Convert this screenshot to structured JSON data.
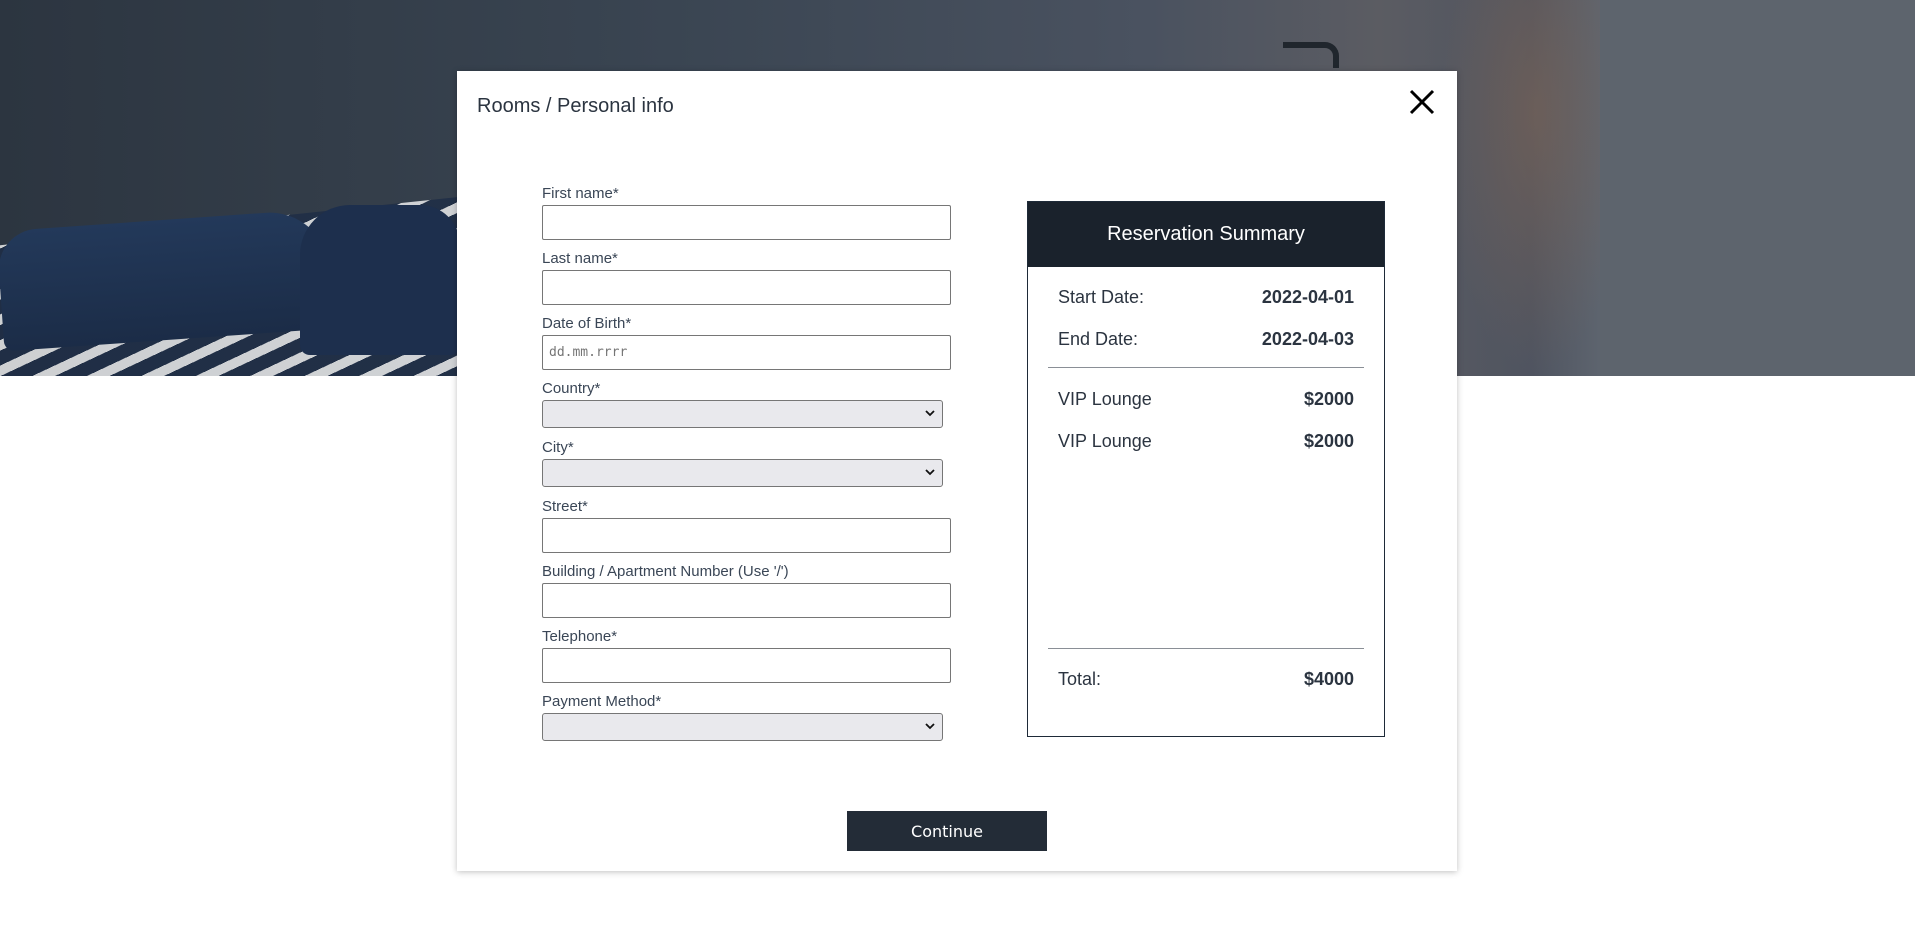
{
  "breadcrumb": "Rooms / Personal info",
  "form": {
    "first_name_label": "First name*",
    "last_name_label": "Last name*",
    "dob_label": "Date of Birth*",
    "dob_placeholder": "dd.mm.rrrr",
    "country_label": "Country*",
    "city_label": "City*",
    "street_label": "Street*",
    "building_label": "Building / Apartment Number (Use '/')",
    "telephone_label": "Telephone*",
    "payment_label": "Payment Method*"
  },
  "summary": {
    "title": "Reservation Summary",
    "start_label": "Start Date:",
    "start_value": "2022-04-01",
    "end_label": "End Date:",
    "end_value": "2022-04-03",
    "items": [
      {
        "name": "VIP Lounge",
        "price": "$2000"
      },
      {
        "name": "VIP Lounge",
        "price": "$2000"
      }
    ],
    "total_label": "Total:",
    "total_value": "$4000"
  },
  "continue_label": "Continue",
  "colors": {
    "header_bg": "#1a222c",
    "button_bg": "#232c37",
    "text": "#2b3440"
  },
  "icons": {
    "close": "close-icon",
    "select_chevron": "chevron-down-icon"
  }
}
